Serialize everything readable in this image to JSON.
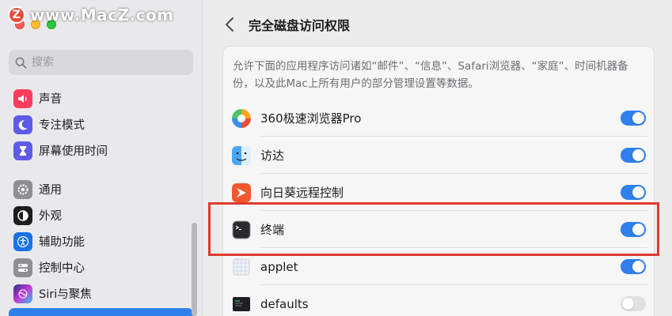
{
  "watermark": {
    "text": "www.MacZ.com"
  },
  "sidebar": {
    "search_placeholder": "搜索",
    "items": [
      {
        "label": "声音",
        "icon": "speaker-icon",
        "color": "#ff3b5c"
      },
      {
        "label": "专注模式",
        "icon": "moon-icon",
        "color": "#5e5ce6"
      },
      {
        "label": "屏幕使用时间",
        "icon": "hourglass-icon",
        "color": "#5e5ce6"
      },
      {
        "label": "通用",
        "icon": "gear-icon",
        "color": "#8e8e93"
      },
      {
        "label": "外观",
        "icon": "appearance-icon",
        "color": "#1d1d1f"
      },
      {
        "label": "辅助功能",
        "icon": "accessibility-icon",
        "color": "#1a73e8"
      },
      {
        "label": "控制中心",
        "icon": "control-center-icon",
        "color": "#8e8e93"
      },
      {
        "label": "Siri与聚焦",
        "icon": "siri-icon",
        "color": "#5e5ce6"
      }
    ]
  },
  "main": {
    "title": "完全磁盘访问权限",
    "description": "允许下面的应用程序访问诸如“邮件”、“信息”、Safari浏览器、“家庭”、时间机器备份，以及此Mac上所有用户的部分管理设置等数据。",
    "apps": [
      {
        "name": "360极速浏览器Pro",
        "icon": "360-browser-icon",
        "enabled": true
      },
      {
        "name": "访达",
        "icon": "finder-icon",
        "enabled": true
      },
      {
        "name": "向日葵远程控制",
        "icon": "sunlogin-icon",
        "enabled": true
      },
      {
        "name": "终端",
        "icon": "terminal-icon",
        "enabled": true
      },
      {
        "name": "applet",
        "icon": "applet-icon",
        "enabled": true
      },
      {
        "name": "defaults",
        "icon": "exec-icon",
        "enabled": false
      }
    ]
  },
  "colors": {
    "accent": "#2f80ed",
    "highlight": "#e03a2f"
  }
}
